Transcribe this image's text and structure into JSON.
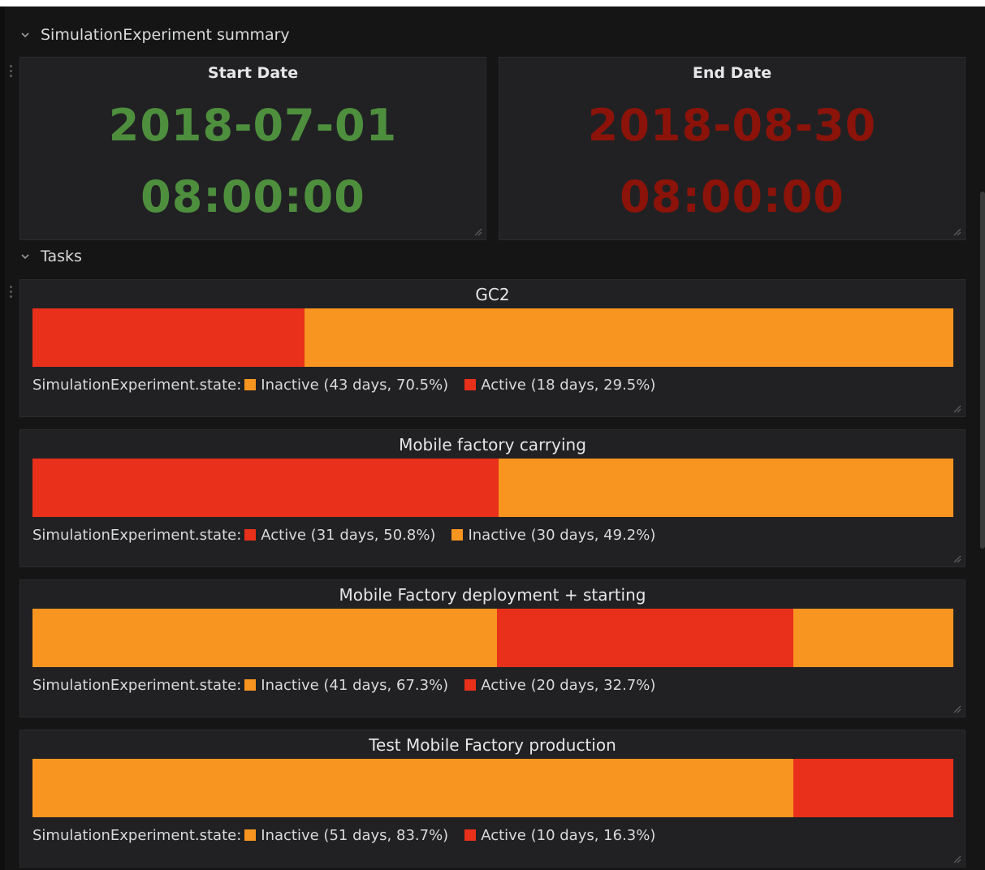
{
  "colors": {
    "inactive": "#f79520",
    "active": "#e8301a",
    "start_value": "#4e8f3e",
    "end_value": "#8b1309",
    "panel_bg": "#212124",
    "page_bg": "#151515"
  },
  "rows": {
    "summary_title": "SimulationExperiment summary",
    "tasks_title": "Tasks"
  },
  "summary": {
    "start": {
      "title": "Start Date",
      "date": "2018-07-01",
      "time": "08:00:00"
    },
    "end": {
      "title": "End Date",
      "date": "2018-08-30",
      "time": "08:00:00"
    }
  },
  "tasks": [
    {
      "title": "GC2",
      "legend_prefix": "SimulationExperiment.state:",
      "segments": [
        {
          "state": "active",
          "fraction": 0.295
        },
        {
          "state": "inactive",
          "fraction": 0.705
        }
      ],
      "legend": [
        {
          "state": "inactive",
          "label": "Inactive (43 days, 70.5%)"
        },
        {
          "state": "active",
          "label": "Active (18 days, 29.5%)"
        }
      ]
    },
    {
      "title": "Mobile factory carrying",
      "legend_prefix": "SimulationExperiment.state:",
      "segments": [
        {
          "state": "active",
          "fraction": 0.506
        },
        {
          "state": "inactive",
          "fraction": 0.494
        }
      ],
      "legend": [
        {
          "state": "active",
          "label": "Active (31 days, 50.8%)"
        },
        {
          "state": "inactive",
          "label": "Inactive (30 days, 49.2%)"
        }
      ]
    },
    {
      "title": "Mobile Factory deployment + starting",
      "legend_prefix": "SimulationExperiment.state:",
      "segments": [
        {
          "state": "inactive",
          "fraction": 0.504
        },
        {
          "state": "active",
          "fraction": 0.322
        },
        {
          "state": "inactive",
          "fraction": 0.174
        }
      ],
      "legend": [
        {
          "state": "inactive",
          "label": "Inactive (41 days, 67.3%)"
        },
        {
          "state": "active",
          "label": "Active (20 days, 32.7%)"
        }
      ]
    },
    {
      "title": "Test Mobile Factory production",
      "legend_prefix": "SimulationExperiment.state:",
      "segments": [
        {
          "state": "inactive",
          "fraction": 0.826
        },
        {
          "state": "active",
          "fraction": 0.174
        }
      ],
      "legend": [
        {
          "state": "inactive",
          "label": "Inactive (51 days, 83.7%)"
        },
        {
          "state": "active",
          "label": "Active (10 days, 16.3%)"
        }
      ]
    }
  ]
}
